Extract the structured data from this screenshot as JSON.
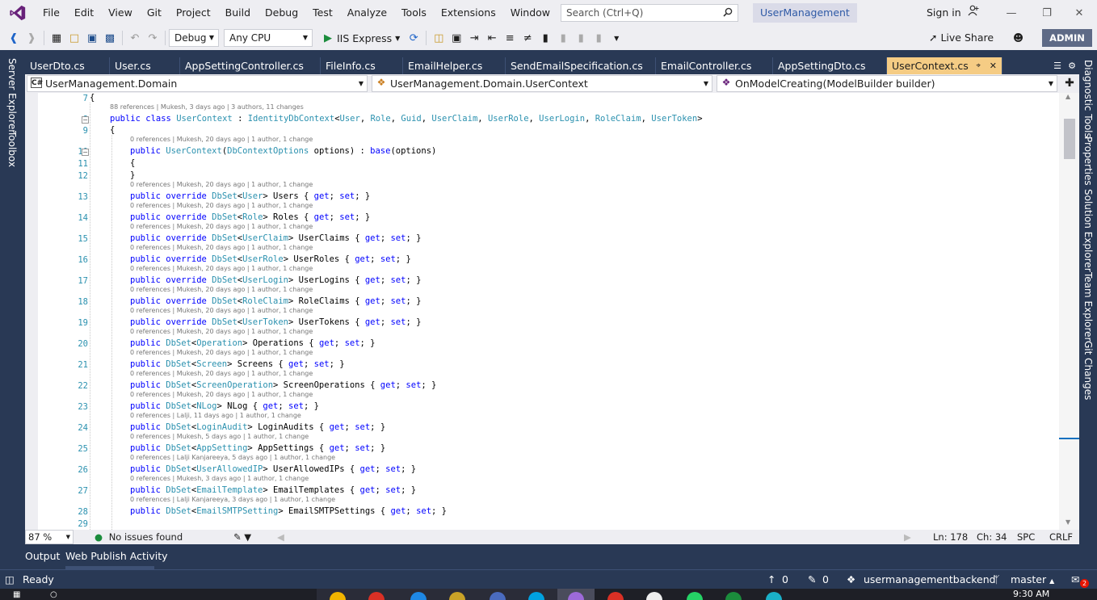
{
  "menubar": {
    "items": [
      "File",
      "Edit",
      "View",
      "Git",
      "Project",
      "Build",
      "Debug",
      "Test",
      "Analyze",
      "Tools",
      "Extensions",
      "Window",
      "Help"
    ],
    "search_placeholder": "Search (Ctrl+Q)",
    "solution_name": "UserManagement",
    "sign_in": "Sign in"
  },
  "toolbar": {
    "config": "Debug",
    "platform": "Any CPU",
    "run_target": "IIS Express",
    "live_share": "Live Share",
    "user_badge": "ADMIN"
  },
  "left_rail": [
    "Server Explorer",
    "Toolbox"
  ],
  "right_rail": [
    "Diagnostic Tools",
    "Properties",
    "Solution Explorer",
    "Team Explorer",
    "Git Changes"
  ],
  "tabs": [
    "UserDto.cs",
    "User.cs",
    "AppSettingController.cs",
    "FileInfo.cs",
    "EmailHelper.cs",
    "SendEmailSpecification.cs",
    "EmailController.cs",
    "AppSettingDto.cs",
    "UserContext.cs"
  ],
  "navbar": {
    "project": "UserManagement.Domain",
    "class": "UserManagement.Domain.UserContext",
    "member": "OnModelCreating(ModelBuilder builder)"
  },
  "code": [
    {
      "n": "7",
      "text": "{"
    },
    {
      "n": "8",
      "lens": "88 references | Mukesh, 3 days ago | 3 authors, 11 changes",
      "text": "public class UserContext : IdentityDbContext<User, Role, Guid, UserClaim, UserRole, UserLogin, RoleClaim, UserToken>"
    },
    {
      "n": "9",
      "text": "{"
    },
    {
      "n": "10",
      "lens": "0 references | Mukesh, 20 days ago | 1 author, 1 change",
      "text": "public UserContext(DbContextOptions options) : base(options)"
    },
    {
      "n": "11",
      "text": "{"
    },
    {
      "n": "12",
      "text": "}"
    },
    {
      "n": "13",
      "lens": "0 references | Mukesh, 20 days ago | 1 author, 1 change",
      "text": "public override DbSet<User> Users { get; set; }"
    },
    {
      "n": "14",
      "lens": "0 references | Mukesh, 20 days ago | 1 author, 1 change",
      "text": "public override DbSet<Role> Roles { get; set; }"
    },
    {
      "n": "15",
      "lens": "0 references | Mukesh, 20 days ago | 1 author, 1 change",
      "text": "public override DbSet<UserClaim> UserClaims { get; set; }"
    },
    {
      "n": "16",
      "lens": "0 references | Mukesh, 20 days ago | 1 author, 1 change",
      "text": "public override DbSet<UserRole> UserRoles { get; set; }"
    },
    {
      "n": "17",
      "lens": "0 references | Mukesh, 20 days ago | 1 author, 1 change",
      "text": "public override DbSet<UserLogin> UserLogins { get; set; }"
    },
    {
      "n": "18",
      "lens": "0 references | Mukesh, 20 days ago | 1 author, 1 change",
      "text": "public override DbSet<RoleClaim> RoleClaims { get; set; }"
    },
    {
      "n": "19",
      "lens": "0 references | Mukesh, 20 days ago | 1 author, 1 change",
      "text": "public override DbSet<UserToken> UserTokens { get; set; }"
    },
    {
      "n": "20",
      "lens": "0 references | Mukesh, 20 days ago | 1 author, 1 change",
      "text": "public DbSet<Operation> Operations { get; set; }"
    },
    {
      "n": "21",
      "lens": "0 references | Mukesh, 20 days ago | 1 author, 1 change",
      "text": "public DbSet<Screen> Screens { get; set; }"
    },
    {
      "n": "22",
      "lens": "0 references | Mukesh, 20 days ago | 1 author, 1 change",
      "text": "public DbSet<ScreenOperation> ScreenOperations { get; set; }"
    },
    {
      "n": "23",
      "lens": "0 references | Mukesh, 20 days ago | 1 author, 1 change",
      "text": "public DbSet<NLog> NLog { get; set; }"
    },
    {
      "n": "24",
      "lens": "0 references | Lalji, 11 days ago | 1 author, 1 change",
      "text": "public DbSet<LoginAudit> LoginAudits { get; set; }"
    },
    {
      "n": "25",
      "lens": "0 references | Mukesh, 5 days ago | 1 author, 1 change",
      "text": "public DbSet<AppSetting> AppSettings { get; set; }"
    },
    {
      "n": "26",
      "lens": "0 references | Lalji Kanjareeya, 5 days ago | 1 author, 1 change",
      "text": "public DbSet<UserAllowedIP> UserAllowedIPs { get; set; }"
    },
    {
      "n": "27",
      "lens": "0 references | Mukesh, 3 days ago | 1 author, 1 change",
      "text": "public DbSet<EmailTemplate> EmailTemplates { get; set; }"
    },
    {
      "n": "28",
      "lens": "0 references | Lalji Kanjareeya, 3 days ago | 1 author, 1 change",
      "text": "public DbSet<EmailSMTPSetting> EmailSMTPSettings { get; set; }"
    },
    {
      "n": "29",
      "text": ""
    }
  ],
  "editor_status": {
    "zoom": "87 %",
    "issues": "No issues found",
    "line": "Ln: 178",
    "col": "Ch: 34",
    "spacing": "SPC",
    "eol": "CRLF"
  },
  "bottom_tabs": [
    "Output",
    "Web Publish Activity"
  ],
  "status": {
    "ready": "Ready",
    "up_count": "0",
    "edit_count": "0",
    "repo": "usermanagementbackend",
    "branch": "master",
    "notif_count": "2"
  },
  "taskbar": {
    "time": "9:30 AM"
  },
  "colors": {
    "accent": "#293955",
    "active_tab": "#f5cc84",
    "keyword": "#0000ff",
    "type": "#2b91af",
    "linenum": "#2b91af"
  }
}
